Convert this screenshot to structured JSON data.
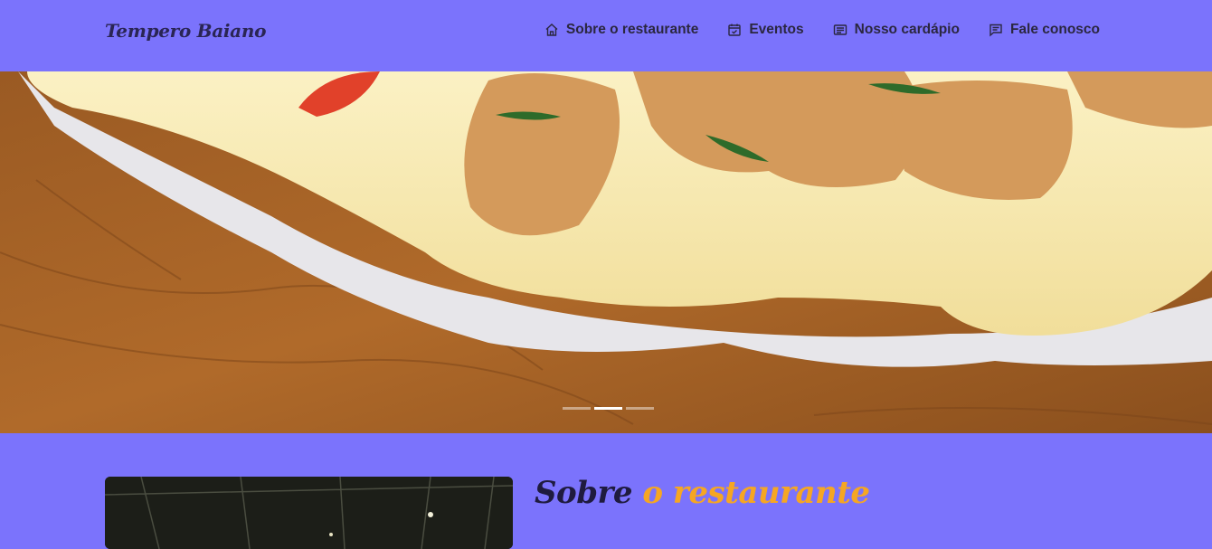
{
  "header": {
    "brand": "Tempero Baiano",
    "nav": [
      {
        "label": "Sobre o restaurante",
        "icon": "home-icon"
      },
      {
        "label": "Eventos",
        "icon": "calendar-check-icon"
      },
      {
        "label": "Nosso cardápio",
        "icon": "menu-card-icon"
      },
      {
        "label": "Fale conosco",
        "icon": "chat-icon"
      }
    ]
  },
  "hero": {
    "image": "tapioca-with-cheese-and-chicken",
    "slides": 3,
    "active_slide": 2
  },
  "about": {
    "title_part1": "Sobre",
    "title_part2": "o restaurante",
    "image": "restaurant-interior"
  },
  "colors": {
    "background": "#7b73fc",
    "accent": "#f5a623",
    "text_dark": "#2b2740"
  }
}
